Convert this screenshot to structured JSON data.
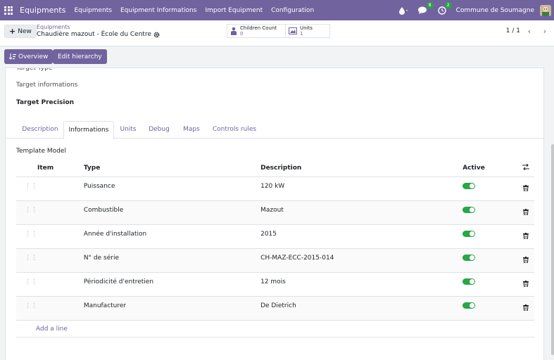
{
  "navbar": {
    "brand": "Equipments",
    "menu": [
      "Equipments",
      "Equipment Informations",
      "Import Equipment",
      "Configuration"
    ],
    "chat_badge": "8",
    "activity_badge": "2",
    "company": "Commune de Soumagne"
  },
  "control": {
    "new_label": "New",
    "breadcrumb": "Equipments",
    "record_title": "Chaudière mazout - École du Centre",
    "children_label": "Children Count",
    "children_value": "0",
    "units_label": "Units",
    "units_value": "1",
    "pager": "1 / 1"
  },
  "header_buttons": {
    "overview": "Overview",
    "edit_hierarchy": "Edit hierarchy"
  },
  "form": {
    "target_type": "Target Type",
    "target_informations": "Target informations",
    "target_precision": "Target Precision"
  },
  "tabs": [
    "Description",
    "Informations",
    "Units",
    "Debug",
    "Maps",
    "Controls rules"
  ],
  "active_tab": "Informations",
  "section_title": "Template Model",
  "table": {
    "headers": {
      "item": "Item",
      "type": "Type",
      "description": "Description",
      "active": "Active"
    },
    "rows": [
      {
        "type": "Puissance",
        "description": "120 kW"
      },
      {
        "type": "Combustible",
        "description": "Mazout"
      },
      {
        "type": "Année d'installation",
        "description": "2015"
      },
      {
        "type": "N° de série",
        "description": "CH-MAZ-ECC-2015-014"
      },
      {
        "type": "Périodicité d'entretien",
        "description": "12 mois"
      },
      {
        "type": "Manufacturer",
        "description": "De Dietrich"
      }
    ],
    "add_line": "Add a line"
  },
  "colors": {
    "primary": "#71639e",
    "toggle_on": "#28a745"
  }
}
